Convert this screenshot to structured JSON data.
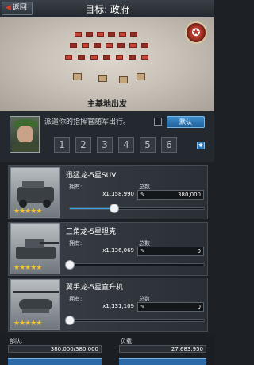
{
  "header": {
    "back_label": "返回",
    "title": "目标: 政府"
  },
  "map": {
    "origin_label": "主基地出发"
  },
  "commander": {
    "dispatch_text": "派遣你的指挥官随军出行。",
    "default_label": "默认",
    "slots": [
      "1",
      "2",
      "3",
      "4",
      "5",
      "6"
    ]
  },
  "units": [
    {
      "name": "迅猛龙-5星SUV",
      "own_label": "拥有:",
      "total_label": "总数",
      "own_value": "x1,158,990",
      "total_value": "380,000",
      "stars": "★★★★★",
      "fill_fraction": 0.33
    },
    {
      "name": "三角龙-5星坦克",
      "own_label": "拥有:",
      "total_label": "总数",
      "own_value": "x1,136,069",
      "total_value": "0",
      "stars": "★★★★★",
      "fill_fraction": 0.0
    },
    {
      "name": "翼手龙-5星直升机",
      "own_label": "拥有:",
      "total_label": "总数",
      "own_value": "x1,131,109",
      "total_value": "0",
      "stars": "★★★★★",
      "fill_fraction": 0.0
    }
  ],
  "footer": {
    "troops_label": "部队:",
    "troops_value": "380,000/380,000",
    "load_label": "负载:",
    "load_value": "27,683,950"
  },
  "colors": {
    "accent": "#3aa1e3",
    "brand_red": "#c44536",
    "star": "#f2c230"
  }
}
